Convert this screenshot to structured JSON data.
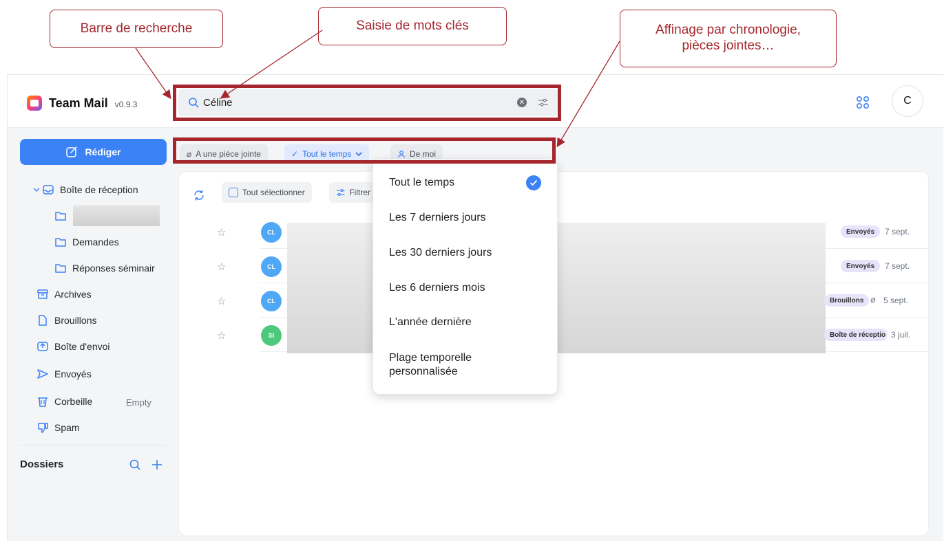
{
  "annotations": {
    "search_bar": "Barre de recherche",
    "keywords": "Saisie de mots clés",
    "refine_line1": "Affinage par chronologie,",
    "refine_line2": "pièces jointes…"
  },
  "app": {
    "name": "Team Mail",
    "version": "v0.9.3",
    "user_initial": "C"
  },
  "search": {
    "query": "Céline"
  },
  "sidebar": {
    "compose_label": "Rédiger",
    "inbox": "Boîte de réception",
    "folder_demandes": "Demandes",
    "folder_reponses": "Réponses séminair",
    "archives": "Archives",
    "brouillons": "Brouillons",
    "boite_envoi": "Boîte d'envoi",
    "envoyes": "Envoyés",
    "corbeille": "Corbeille",
    "corbeille_action": "Empty",
    "spam": "Spam",
    "dossiers": "Dossiers"
  },
  "filters": {
    "attachment": "A une pièce jointe",
    "time": "Tout le temps",
    "from_me": "De moi"
  },
  "toolbar": {
    "select_all": "Tout sélectionner",
    "filter": "Filtrer"
  },
  "dropdown": {
    "items": [
      "Tout le temps",
      "Les 7 derniers jours",
      "Les 30 derniers jours",
      "Les 6 derniers mois",
      "L'année dernière",
      "Plage temporelle",
      "personnalisée"
    ],
    "selected_index": 0
  },
  "emails": [
    {
      "initials": "CL",
      "tag": "Envoyés",
      "date": "7 sept.",
      "color": "#4fa8f5",
      "attachment": false
    },
    {
      "initials": "CL",
      "tag": "Envoyés",
      "date": "7 sept.",
      "color": "#4fa8f5",
      "attachment": false
    },
    {
      "initials": "CL",
      "tag": "Brouillons",
      "date": "5 sept.",
      "color": "#4fa8f5",
      "attachment": true
    },
    {
      "initials": "SI",
      "tag": "Boîte de réceptio",
      "date": "3 juil.",
      "color": "#4cc97a",
      "attachment": false
    }
  ],
  "colors": {
    "accent": "#3b82f6",
    "annotation": "#a5262d"
  }
}
